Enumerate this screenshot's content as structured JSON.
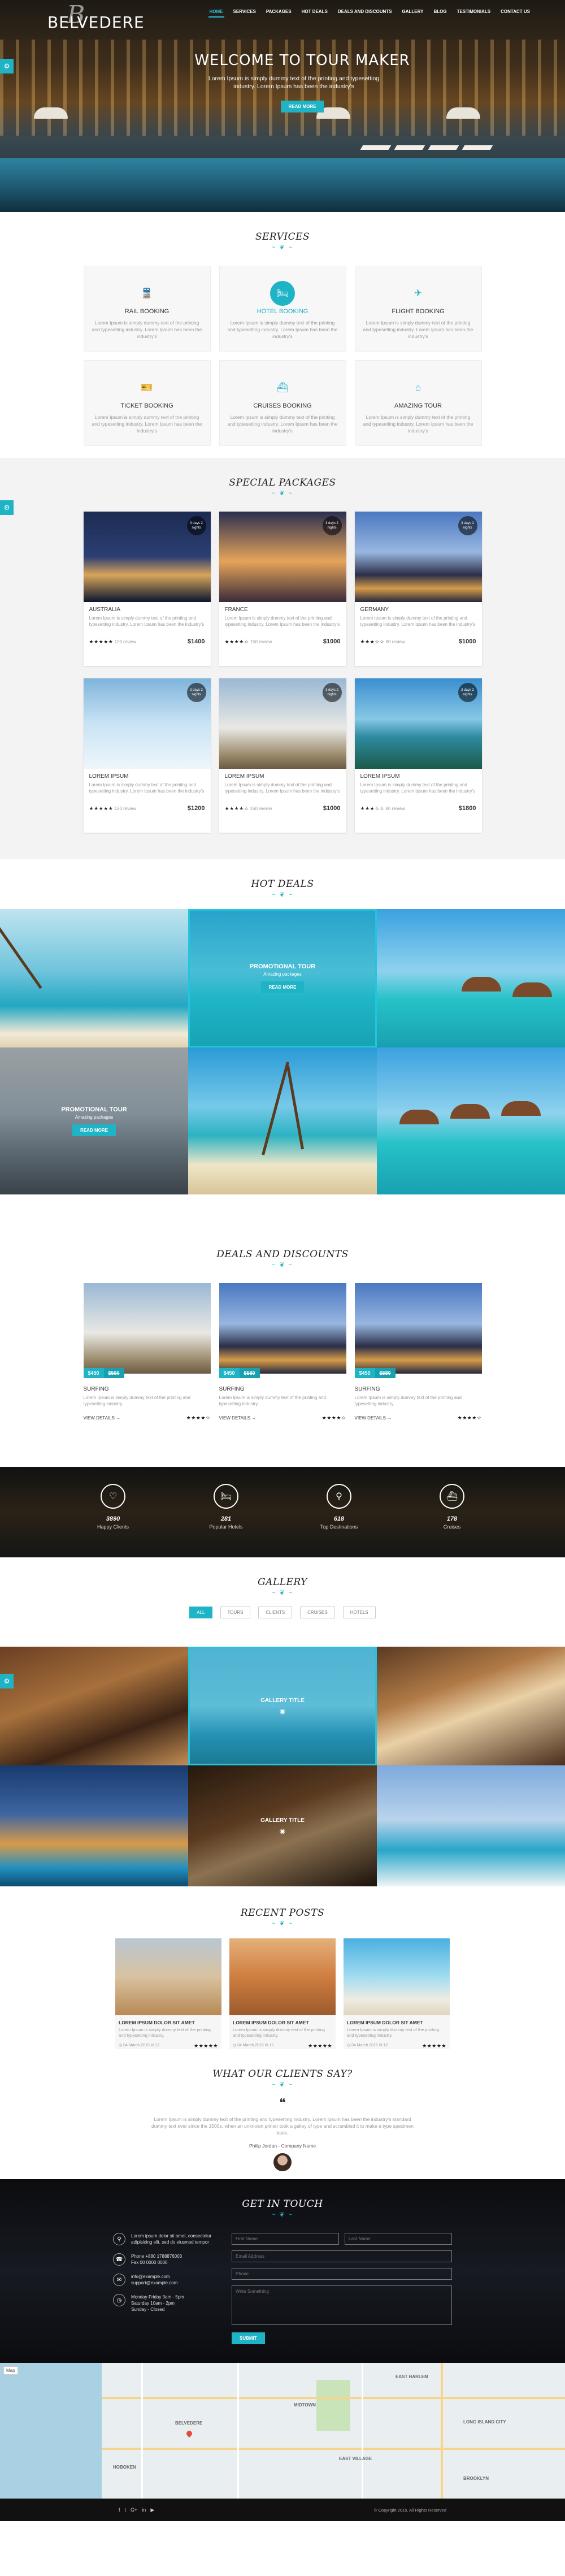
{
  "nav": {
    "logo": "BELVEDERE",
    "logo_mark": "B",
    "items": [
      "HOME",
      "SERVICES",
      "PACKAGES",
      "HOT DEALS",
      "DEALS AND DISCOUNTS",
      "GALLERY",
      "BLOG",
      "TESTIMONIALS",
      "CONTACT US"
    ],
    "active_index": 0
  },
  "hero": {
    "title": "WELCOME TO TOUR MAKER",
    "subtitle": "Lorem Ipsum is simply dummy text of the printing and typesetting industry. Lorem Ipsum has been the industry's",
    "button": "READ MORE"
  },
  "services": {
    "title": "SERVICES",
    "items": [
      {
        "name": "RAIL BOOKING",
        "icon": "train-icon",
        "text": "Lorem Ipsum is simply dummy text of the printing and typesetting industry. Lorem Ipsum has been the industry's",
        "highlighted": false
      },
      {
        "name": "HOTEL BOOKING",
        "icon": "hotel-icon",
        "text": "Lorem Ipsum is simply dummy text of the printing and typesetting industry. Lorem Ipsum has been the industry's",
        "highlighted": true
      },
      {
        "name": "FLIGHT BOOKING",
        "icon": "plane-icon",
        "text": "Lorem Ipsum is simply dummy text of the printing and typesetting industry. Lorem Ipsum has been the industry's",
        "highlighted": false
      },
      {
        "name": "TICKET BOOKING",
        "icon": "ticket-icon",
        "text": "Lorem Ipsum is simply dummy text of the printing and typesetting industry. Lorem Ipsum has been the industry's",
        "highlighted": false
      },
      {
        "name": "CRUISES BOOKING",
        "icon": "ship-icon",
        "text": "Lorem Ipsum is simply dummy text of the printing and typesetting industry. Lorem Ipsum has been the industry's",
        "highlighted": false
      },
      {
        "name": "AMAZING TOUR",
        "icon": "home-icon",
        "text": "Lorem Ipsum is simply dummy text of the printing and typesetting industry. Lorem Ipsum has been the industry's",
        "highlighted": false
      }
    ]
  },
  "packages": {
    "title": "SPECIAL PACKAGES",
    "items": [
      {
        "name": "AUSTRALIA",
        "badge": "3 days 2 nights",
        "text": "Lorem Ipsum is simply dummy text of the printing and typesetting industry. Lorem Ipsum has been the industry's",
        "stars": "★★★★★",
        "reviews": "120 review",
        "price": "$1400"
      },
      {
        "name": "FRANCE",
        "badge": "3 days 2 nights",
        "text": "Lorem Ipsum is simply dummy text of the printing and typesetting industry. Lorem Ipsum has been the industry's",
        "stars": "★★★★☆",
        "reviews": "150 review",
        "price": "$1000"
      },
      {
        "name": "GERMANY",
        "badge": "3 days 2 nights",
        "text": "Lorem Ipsum is simply dummy text of the printing and typesetting industry. Lorem Ipsum has been the industry's",
        "stars": "★★★☆☆",
        "reviews": "80 review",
        "price": "$1000"
      },
      {
        "name": "LOREM IPSUM",
        "badge": "3 days 2 nights",
        "text": "Lorem Ipsum is simply dummy text of the printing and typesetting industry. Lorem Ipsum has been the industry's",
        "stars": "★★★★★",
        "reviews": "120 review",
        "price": "$1200"
      },
      {
        "name": "LOREM IPSUM",
        "badge": "3 days 2 nights",
        "text": "Lorem Ipsum is simply dummy text of the printing and typesetting industry. Lorem Ipsum has been the industry's",
        "stars": "★★★★☆",
        "reviews": "150 review",
        "price": "$1000"
      },
      {
        "name": "LOREM IPSUM",
        "badge": "3 days 2 nights",
        "text": "Lorem Ipsum is simply dummy text of the printing and typesetting industry. Lorem Ipsum has been the industry's",
        "stars": "★★★☆☆",
        "reviews": "80 review",
        "price": "$1800"
      }
    ]
  },
  "hot_deals": {
    "title": "HOT DEALS",
    "promo_title": "PROMOTIONAL TOUR",
    "promo_sub": "Amazing packages",
    "button": "READ MORE"
  },
  "deals": {
    "title": "DEALS AND DISCOUNTS",
    "items": [
      {
        "name": "SURFING",
        "price": "$450",
        "old_price": "$580",
        "text": "Lorem Ipsum is simply dummy text of the printing and typesetting industry.",
        "link": "VIEW DETAILS →",
        "stars": "★★★★☆"
      },
      {
        "name": "SURFING",
        "price": "$450",
        "old_price": "$580",
        "text": "Lorem Ipsum is simply dummy text of the printing and typesetting industry.",
        "link": "VIEW DETAILS →",
        "stars": "★★★★☆"
      },
      {
        "name": "SURFING",
        "price": "$450",
        "old_price": "$580",
        "text": "Lorem Ipsum is simply dummy text of the printing and typesetting industry.",
        "link": "VIEW DETAILS →",
        "stars": "★★★★☆"
      }
    ]
  },
  "stats": [
    {
      "value": "3890",
      "label": "Happy Clients",
      "icon": "heart-icon"
    },
    {
      "value": "281",
      "label": "Popular Hotels",
      "icon": "bed-icon"
    },
    {
      "value": "618",
      "label": "Top Destinations",
      "icon": "map-pin-icon"
    },
    {
      "value": "178",
      "label": "Cruises",
      "icon": "ship-icon"
    }
  ],
  "gallery": {
    "title": "GALLERY",
    "filters": [
      "ALL",
      "TOURS",
      "CLIENTS",
      "CRUISES",
      "HOTELS"
    ],
    "active_filter": 0,
    "item_title": "GALLERY TITLE"
  },
  "posts": {
    "title": "RECENT POSTS",
    "items": [
      {
        "title": "LOREM IPSUM DOLOR SIT AMET",
        "text": "Lorem Ipsum is simply dummy text of the printing and typesetting industry.",
        "date": "04 March 2015",
        "comments": "12",
        "stars": "★★★★★"
      },
      {
        "title": "LOREM IPSUM DOLOR SIT AMET",
        "text": "Lorem Ipsum is simply dummy text of the printing and typesetting industry.",
        "date": "04 March 2015",
        "comments": "12",
        "stars": "★★★★★"
      },
      {
        "title": "LOREM IPSUM DOLOR SIT AMET",
        "text": "Lorem Ipsum is simply dummy text of the printing and typesetting industry.",
        "date": "04 March 2015",
        "comments": "12",
        "stars": "★★★★★"
      }
    ]
  },
  "testimonial": {
    "title": "WHAT OUR CLIENTS SAY?",
    "text": "Lorem Ipsum is simply dummy text of the printing and typesetting industry. Lorem Ipsum has been the industry's standard dummy text ever since the 1500s, when an unknown printer took a galley of type and scrambled it to make a type specimen book.",
    "author": "Philip Jordan - Company Name"
  },
  "contact": {
    "title": "GET IN TOUCH",
    "address": "Lorem ipsum dolor sit amet, consectetur adipisicing elit, sed do eiusmod tempor",
    "phone": "Phone +880 1788876003\nFax 00 0000 0000",
    "email": "info@example.com\nsupport@example.com",
    "hours": "Monday-Friday 9am - 5pm\nSaturday 10am - 2pm\nSunday - Closed",
    "first_name": "First Name",
    "last_name": "Last Name",
    "email_ph": "Email Address",
    "phone_ph": "Phone",
    "message_ph": "Write Something",
    "submit": "SUBMIT"
  },
  "map": {
    "control": "Map",
    "labels": [
      "BELVEDERE",
      "MIDTOWN",
      "EAST VILLAGE",
      "EAST HARLEM",
      "BROOKLYN",
      "HOBOKEN",
      "LONG ISLAND CITY"
    ]
  },
  "footer": {
    "socials": [
      "f",
      "t",
      "G+",
      "in",
      "▶"
    ],
    "copyright": "© Copyright 2015. All Rights Reserved"
  }
}
